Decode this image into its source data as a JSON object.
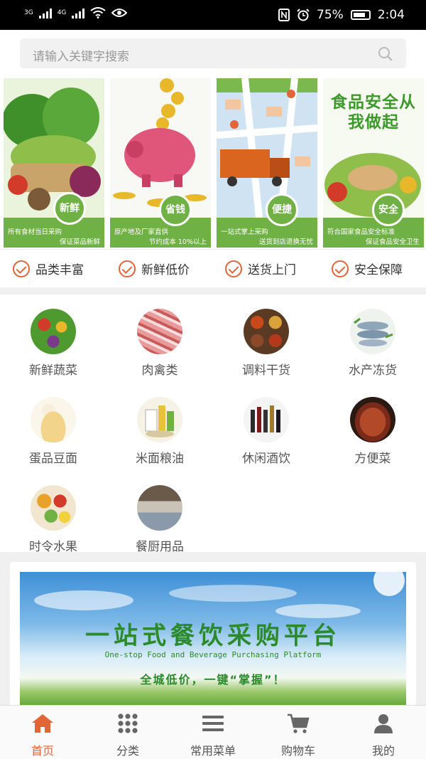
{
  "status_bar": {
    "network1": "3G",
    "network2": "4G",
    "battery": "75%",
    "time": "2:04"
  },
  "search": {
    "placeholder": "请输入关键字搜索"
  },
  "banners": [
    {
      "badge": "新鲜",
      "caption1": "所有食材当日采购",
      "caption2": "保证菜品新鲜"
    },
    {
      "badge": "省钱",
      "caption1": "原产地及厂家直供",
      "caption2": "节约成本 10%以上"
    },
    {
      "badge": "便捷",
      "caption1": "一站式掌上采购",
      "caption2": "送货到店退换无忧"
    },
    {
      "badge": "安全",
      "caption1": "符合国家食品安全标准",
      "caption2": "保证食品安全卫生",
      "headline": "食品安全从我做起"
    }
  ],
  "features": [
    "品类丰富",
    "新鲜低价",
    "送货上门",
    "安全保障"
  ],
  "categories": [
    {
      "label": "新鲜蔬菜",
      "icon": "vegetables-icon"
    },
    {
      "label": "肉禽类",
      "icon": "meat-icon"
    },
    {
      "label": "调料干货",
      "icon": "spices-icon"
    },
    {
      "label": "水产冻货",
      "icon": "fish-icon"
    },
    {
      "label": "蛋品豆面",
      "icon": "eggs-noodles-icon"
    },
    {
      "label": "米面粮油",
      "icon": "rice-oil-icon"
    },
    {
      "label": "休闲酒饮",
      "icon": "drinks-icon"
    },
    {
      "label": "方便菜",
      "icon": "prepared-dish-icon"
    },
    {
      "label": "时令水果",
      "icon": "fruit-icon"
    },
    {
      "label": "餐厨用品",
      "icon": "kitchenware-icon"
    }
  ],
  "promo": {
    "title": "一站式餐饮采购平台",
    "subtitle": "One-stop Food and Beverage Purchasing Platform",
    "slogan": "全城低价，一键“掌握”！"
  },
  "tabs": [
    {
      "label": "首页",
      "icon": "home-icon",
      "active": true
    },
    {
      "label": "分类",
      "icon": "grid-icon",
      "active": false
    },
    {
      "label": "常用菜单",
      "icon": "menu-icon",
      "active": false
    },
    {
      "label": "购物车",
      "icon": "cart-icon",
      "active": false
    },
    {
      "label": "我的",
      "icon": "user-icon",
      "active": false
    }
  ],
  "colors": {
    "accent": "#e4643a",
    "brand_green": "#6fb144"
  }
}
